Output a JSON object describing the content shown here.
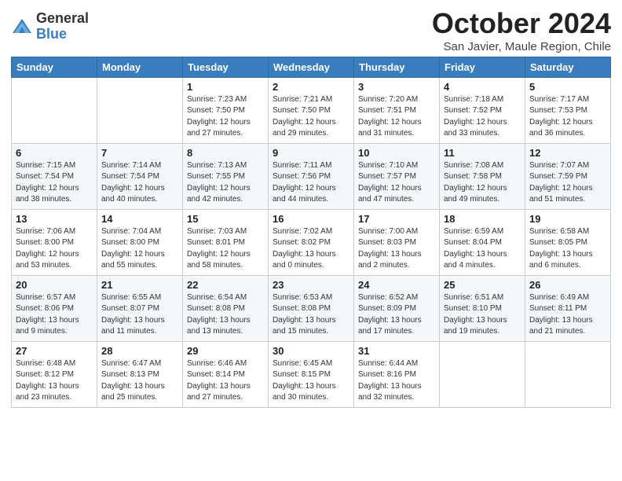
{
  "logo": {
    "general": "General",
    "blue": "Blue"
  },
  "title": "October 2024",
  "subtitle": "San Javier, Maule Region, Chile",
  "days_of_week": [
    "Sunday",
    "Monday",
    "Tuesday",
    "Wednesday",
    "Thursday",
    "Friday",
    "Saturday"
  ],
  "weeks": [
    [
      {
        "day": "",
        "info": ""
      },
      {
        "day": "",
        "info": ""
      },
      {
        "day": "1",
        "info": "Sunrise: 7:23 AM\nSunset: 7:50 PM\nDaylight: 12 hours\nand 27 minutes."
      },
      {
        "day": "2",
        "info": "Sunrise: 7:21 AM\nSunset: 7:50 PM\nDaylight: 12 hours\nand 29 minutes."
      },
      {
        "day": "3",
        "info": "Sunrise: 7:20 AM\nSunset: 7:51 PM\nDaylight: 12 hours\nand 31 minutes."
      },
      {
        "day": "4",
        "info": "Sunrise: 7:18 AM\nSunset: 7:52 PM\nDaylight: 12 hours\nand 33 minutes."
      },
      {
        "day": "5",
        "info": "Sunrise: 7:17 AM\nSunset: 7:53 PM\nDaylight: 12 hours\nand 36 minutes."
      }
    ],
    [
      {
        "day": "6",
        "info": "Sunrise: 7:15 AM\nSunset: 7:54 PM\nDaylight: 12 hours\nand 38 minutes."
      },
      {
        "day": "7",
        "info": "Sunrise: 7:14 AM\nSunset: 7:54 PM\nDaylight: 12 hours\nand 40 minutes."
      },
      {
        "day": "8",
        "info": "Sunrise: 7:13 AM\nSunset: 7:55 PM\nDaylight: 12 hours\nand 42 minutes."
      },
      {
        "day": "9",
        "info": "Sunrise: 7:11 AM\nSunset: 7:56 PM\nDaylight: 12 hours\nand 44 minutes."
      },
      {
        "day": "10",
        "info": "Sunrise: 7:10 AM\nSunset: 7:57 PM\nDaylight: 12 hours\nand 47 minutes."
      },
      {
        "day": "11",
        "info": "Sunrise: 7:08 AM\nSunset: 7:58 PM\nDaylight: 12 hours\nand 49 minutes."
      },
      {
        "day": "12",
        "info": "Sunrise: 7:07 AM\nSunset: 7:59 PM\nDaylight: 12 hours\nand 51 minutes."
      }
    ],
    [
      {
        "day": "13",
        "info": "Sunrise: 7:06 AM\nSunset: 8:00 PM\nDaylight: 12 hours\nand 53 minutes."
      },
      {
        "day": "14",
        "info": "Sunrise: 7:04 AM\nSunset: 8:00 PM\nDaylight: 12 hours\nand 55 minutes."
      },
      {
        "day": "15",
        "info": "Sunrise: 7:03 AM\nSunset: 8:01 PM\nDaylight: 12 hours\nand 58 minutes."
      },
      {
        "day": "16",
        "info": "Sunrise: 7:02 AM\nSunset: 8:02 PM\nDaylight: 13 hours\nand 0 minutes."
      },
      {
        "day": "17",
        "info": "Sunrise: 7:00 AM\nSunset: 8:03 PM\nDaylight: 13 hours\nand 2 minutes."
      },
      {
        "day": "18",
        "info": "Sunrise: 6:59 AM\nSunset: 8:04 PM\nDaylight: 13 hours\nand 4 minutes."
      },
      {
        "day": "19",
        "info": "Sunrise: 6:58 AM\nSunset: 8:05 PM\nDaylight: 13 hours\nand 6 minutes."
      }
    ],
    [
      {
        "day": "20",
        "info": "Sunrise: 6:57 AM\nSunset: 8:06 PM\nDaylight: 13 hours\nand 9 minutes."
      },
      {
        "day": "21",
        "info": "Sunrise: 6:55 AM\nSunset: 8:07 PM\nDaylight: 13 hours\nand 11 minutes."
      },
      {
        "day": "22",
        "info": "Sunrise: 6:54 AM\nSunset: 8:08 PM\nDaylight: 13 hours\nand 13 minutes."
      },
      {
        "day": "23",
        "info": "Sunrise: 6:53 AM\nSunset: 8:08 PM\nDaylight: 13 hours\nand 15 minutes."
      },
      {
        "day": "24",
        "info": "Sunrise: 6:52 AM\nSunset: 8:09 PM\nDaylight: 13 hours\nand 17 minutes."
      },
      {
        "day": "25",
        "info": "Sunrise: 6:51 AM\nSunset: 8:10 PM\nDaylight: 13 hours\nand 19 minutes."
      },
      {
        "day": "26",
        "info": "Sunrise: 6:49 AM\nSunset: 8:11 PM\nDaylight: 13 hours\nand 21 minutes."
      }
    ],
    [
      {
        "day": "27",
        "info": "Sunrise: 6:48 AM\nSunset: 8:12 PM\nDaylight: 13 hours\nand 23 minutes."
      },
      {
        "day": "28",
        "info": "Sunrise: 6:47 AM\nSunset: 8:13 PM\nDaylight: 13 hours\nand 25 minutes."
      },
      {
        "day": "29",
        "info": "Sunrise: 6:46 AM\nSunset: 8:14 PM\nDaylight: 13 hours\nand 27 minutes."
      },
      {
        "day": "30",
        "info": "Sunrise: 6:45 AM\nSunset: 8:15 PM\nDaylight: 13 hours\nand 30 minutes."
      },
      {
        "day": "31",
        "info": "Sunrise: 6:44 AM\nSunset: 8:16 PM\nDaylight: 13 hours\nand 32 minutes."
      },
      {
        "day": "",
        "info": ""
      },
      {
        "day": "",
        "info": ""
      }
    ]
  ]
}
